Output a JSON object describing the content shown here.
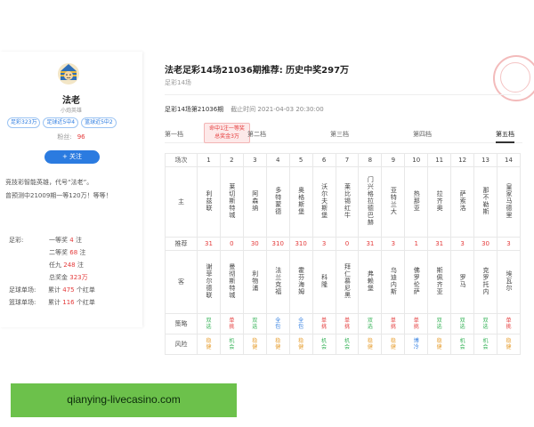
{
  "profile": {
    "name": "法老",
    "sub": "小炮英雄",
    "tags": [
      "足彩323万",
      "足球近5中4",
      "篮球近5中2"
    ],
    "fans_label": "粉丝:",
    "fans_value": "96",
    "follow_label": "+ 关注",
    "intro_lines": [
      "竞技彩智能英雄，代号“法老”。",
      "曾预测中21009期一等120万！等等！"
    ],
    "stats": [
      {
        "label": "足彩:",
        "value": "一等奖 4 注",
        "parts": [
          "一等奖",
          "4",
          "注"
        ]
      },
      {
        "label": "",
        "value": "二等奖 68 注",
        "parts": [
          "二等奖",
          "68",
          "注"
        ]
      },
      {
        "label": "",
        "value": "任九 248 注",
        "parts": [
          "任九",
          "248",
          "注"
        ]
      },
      {
        "label": "",
        "value": "总奖金 323万",
        "parts": [
          "总奖金",
          "323万",
          ""
        ]
      },
      {
        "label": "足球单场:",
        "value": "累计 475 个红单",
        "parts": [
          "累计",
          "475",
          "个红单"
        ]
      },
      {
        "label": "篮球单场:",
        "value": "累计 116 个红单",
        "parts": [
          "累计",
          "116",
          "个红单"
        ]
      }
    ]
  },
  "main": {
    "title": "法老足彩14场21036期推荐: 历史中奖297万",
    "subtitle": "足彩14场",
    "issue": "足彩14场第21036期",
    "deadline": "截止时间 2021-04-03 20:30:00",
    "tooltip": [
      "命中1注一等奖",
      "总奖金3万"
    ],
    "tabs": [
      "第一档",
      "第二档",
      "第三档",
      "第四档",
      "第五档"
    ],
    "active_tab": "第五档"
  },
  "table": {
    "row_labels": {
      "index": "场次",
      "home": "主",
      "pick": "推荐",
      "away": "客",
      "strategy": "策略",
      "risk": "风险"
    },
    "matches": [
      {
        "n": "1",
        "home": "利兹联",
        "pick": "31",
        "away": "谢菲尔德联",
        "strategy": "双选",
        "risk": "稳健"
      },
      {
        "n": "2",
        "home": "莱切斯特城",
        "pick": "0",
        "away": "曼彻斯特城",
        "strategy": "单挑",
        "risk": "机会"
      },
      {
        "n": "3",
        "home": "阿森纳",
        "pick": "30",
        "away": "利物浦",
        "strategy": "双选",
        "risk": "稳健"
      },
      {
        "n": "4",
        "home": "多特蒙德",
        "pick": "310",
        "away": "法兰克福",
        "strategy": "全包",
        "risk": "稳健"
      },
      {
        "n": "5",
        "home": "奥格斯堡",
        "pick": "310",
        "away": "霍芬海姆",
        "strategy": "全包",
        "risk": "稳健"
      },
      {
        "n": "6",
        "home": "沃尔夫斯堡",
        "pick": "3",
        "away": "科隆",
        "strategy": "单挑",
        "risk": "机会"
      },
      {
        "n": "7",
        "home": "莱比锡红牛",
        "pick": "0",
        "away": "拜仁慕尼黑",
        "strategy": "单挑",
        "risk": "机会"
      },
      {
        "n": "8",
        "home": "门兴格拉德巴赫",
        "pick": "31",
        "away": "弗赖堡",
        "strategy": "双选",
        "risk": "稳健"
      },
      {
        "n": "9",
        "home": "亚特兰大",
        "pick": "3",
        "away": "乌迪内斯",
        "strategy": "单挑",
        "risk": "稳健"
      },
      {
        "n": "10",
        "home": "热那亚",
        "pick": "1",
        "away": "佛罗伦萨",
        "strategy": "单挑",
        "risk": "博冷"
      },
      {
        "n": "11",
        "home": "拉齐奥",
        "pick": "31",
        "away": "斯佩齐亚",
        "strategy": "双选",
        "risk": "稳健"
      },
      {
        "n": "12",
        "home": "萨索洛",
        "pick": "3",
        "away": "罗马",
        "strategy": "双选",
        "risk": "机会"
      },
      {
        "n": "13",
        "home": "那不勒斯",
        "pick": "30",
        "away": "克罗托内",
        "strategy": "双选",
        "risk": "机会"
      },
      {
        "n": "14",
        "home": "皇家马德里",
        "pick": "3",
        "away": "埃瓦尔",
        "strategy": "单挑",
        "risk": "稳健"
      }
    ]
  },
  "watermark": "qianying-livecasino.com",
  "colors": {
    "accent": "#2b7be0",
    "red": "#e43b3b",
    "green": "#3bb45c",
    "watermark_bg": "#6cc14b"
  }
}
